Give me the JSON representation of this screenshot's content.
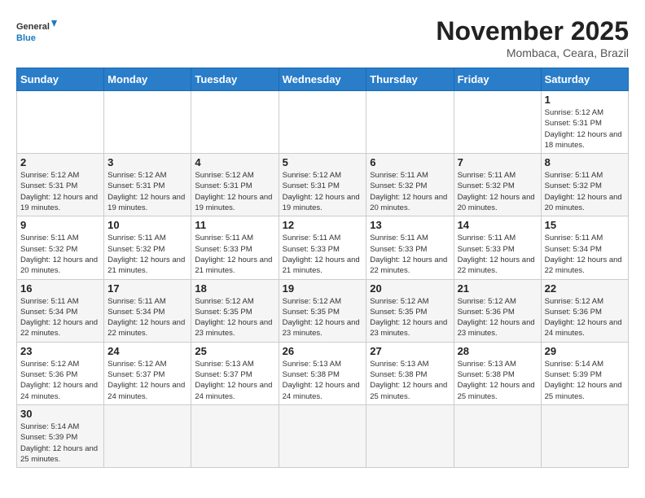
{
  "header": {
    "logo_general": "General",
    "logo_blue": "Blue",
    "title": "November 2025",
    "location": "Mombaca, Ceara, Brazil"
  },
  "weekdays": [
    "Sunday",
    "Monday",
    "Tuesday",
    "Wednesday",
    "Thursday",
    "Friday",
    "Saturday"
  ],
  "weeks": [
    [
      {
        "day": "",
        "info": ""
      },
      {
        "day": "",
        "info": ""
      },
      {
        "day": "",
        "info": ""
      },
      {
        "day": "",
        "info": ""
      },
      {
        "day": "",
        "info": ""
      },
      {
        "day": "",
        "info": ""
      },
      {
        "day": "1",
        "info": "Sunrise: 5:12 AM\nSunset: 5:31 PM\nDaylight: 12 hours\nand 18 minutes."
      }
    ],
    [
      {
        "day": "2",
        "info": "Sunrise: 5:12 AM\nSunset: 5:31 PM\nDaylight: 12 hours\nand 19 minutes."
      },
      {
        "day": "3",
        "info": "Sunrise: 5:12 AM\nSunset: 5:31 PM\nDaylight: 12 hours\nand 19 minutes."
      },
      {
        "day": "4",
        "info": "Sunrise: 5:12 AM\nSunset: 5:31 PM\nDaylight: 12 hours\nand 19 minutes."
      },
      {
        "day": "5",
        "info": "Sunrise: 5:12 AM\nSunset: 5:31 PM\nDaylight: 12 hours\nand 19 minutes."
      },
      {
        "day": "6",
        "info": "Sunrise: 5:11 AM\nSunset: 5:32 PM\nDaylight: 12 hours\nand 20 minutes."
      },
      {
        "day": "7",
        "info": "Sunrise: 5:11 AM\nSunset: 5:32 PM\nDaylight: 12 hours\nand 20 minutes."
      },
      {
        "day": "8",
        "info": "Sunrise: 5:11 AM\nSunset: 5:32 PM\nDaylight: 12 hours\nand 20 minutes."
      }
    ],
    [
      {
        "day": "9",
        "info": "Sunrise: 5:11 AM\nSunset: 5:32 PM\nDaylight: 12 hours\nand 20 minutes."
      },
      {
        "day": "10",
        "info": "Sunrise: 5:11 AM\nSunset: 5:32 PM\nDaylight: 12 hours\nand 21 minutes."
      },
      {
        "day": "11",
        "info": "Sunrise: 5:11 AM\nSunset: 5:33 PM\nDaylight: 12 hours\nand 21 minutes."
      },
      {
        "day": "12",
        "info": "Sunrise: 5:11 AM\nSunset: 5:33 PM\nDaylight: 12 hours\nand 21 minutes."
      },
      {
        "day": "13",
        "info": "Sunrise: 5:11 AM\nSunset: 5:33 PM\nDaylight: 12 hours\nand 22 minutes."
      },
      {
        "day": "14",
        "info": "Sunrise: 5:11 AM\nSunset: 5:33 PM\nDaylight: 12 hours\nand 22 minutes."
      },
      {
        "day": "15",
        "info": "Sunrise: 5:11 AM\nSunset: 5:34 PM\nDaylight: 12 hours\nand 22 minutes."
      }
    ],
    [
      {
        "day": "16",
        "info": "Sunrise: 5:11 AM\nSunset: 5:34 PM\nDaylight: 12 hours\nand 22 minutes."
      },
      {
        "day": "17",
        "info": "Sunrise: 5:11 AM\nSunset: 5:34 PM\nDaylight: 12 hours\nand 22 minutes."
      },
      {
        "day": "18",
        "info": "Sunrise: 5:12 AM\nSunset: 5:35 PM\nDaylight: 12 hours\nand 23 minutes."
      },
      {
        "day": "19",
        "info": "Sunrise: 5:12 AM\nSunset: 5:35 PM\nDaylight: 12 hours\nand 23 minutes."
      },
      {
        "day": "20",
        "info": "Sunrise: 5:12 AM\nSunset: 5:35 PM\nDaylight: 12 hours\nand 23 minutes."
      },
      {
        "day": "21",
        "info": "Sunrise: 5:12 AM\nSunset: 5:36 PM\nDaylight: 12 hours\nand 23 minutes."
      },
      {
        "day": "22",
        "info": "Sunrise: 5:12 AM\nSunset: 5:36 PM\nDaylight: 12 hours\nand 24 minutes."
      }
    ],
    [
      {
        "day": "23",
        "info": "Sunrise: 5:12 AM\nSunset: 5:36 PM\nDaylight: 12 hours\nand 24 minutes."
      },
      {
        "day": "24",
        "info": "Sunrise: 5:12 AM\nSunset: 5:37 PM\nDaylight: 12 hours\nand 24 minutes."
      },
      {
        "day": "25",
        "info": "Sunrise: 5:13 AM\nSunset: 5:37 PM\nDaylight: 12 hours\nand 24 minutes."
      },
      {
        "day": "26",
        "info": "Sunrise: 5:13 AM\nSunset: 5:38 PM\nDaylight: 12 hours\nand 24 minutes."
      },
      {
        "day": "27",
        "info": "Sunrise: 5:13 AM\nSunset: 5:38 PM\nDaylight: 12 hours\nand 25 minutes."
      },
      {
        "day": "28",
        "info": "Sunrise: 5:13 AM\nSunset: 5:38 PM\nDaylight: 12 hours\nand 25 minutes."
      },
      {
        "day": "29",
        "info": "Sunrise: 5:14 AM\nSunset: 5:39 PM\nDaylight: 12 hours\nand 25 minutes."
      }
    ],
    [
      {
        "day": "30",
        "info": "Sunrise: 5:14 AM\nSunset: 5:39 PM\nDaylight: 12 hours\nand 25 minutes."
      },
      {
        "day": "",
        "info": ""
      },
      {
        "day": "",
        "info": ""
      },
      {
        "day": "",
        "info": ""
      },
      {
        "day": "",
        "info": ""
      },
      {
        "day": "",
        "info": ""
      },
      {
        "day": "",
        "info": ""
      }
    ]
  ]
}
